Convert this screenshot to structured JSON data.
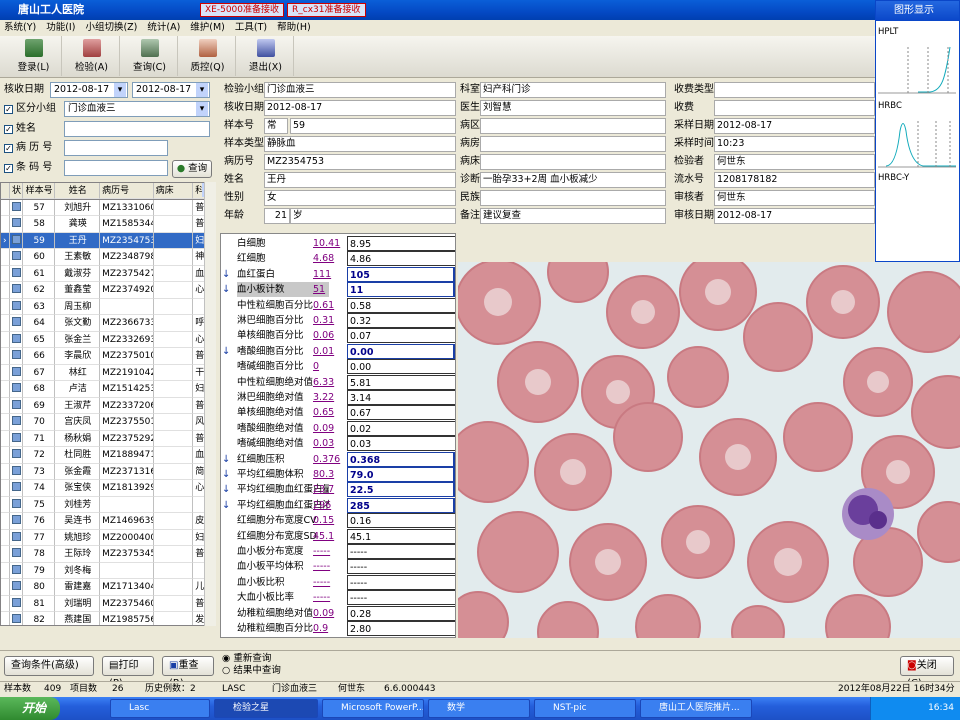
{
  "window": {
    "title": "唐山工人医院",
    "tabs": [
      "XE-5000准备接收",
      "R_cx31准备接收"
    ]
  },
  "menu": [
    "系统(Y)",
    "功能(I)",
    "小组切换(Z)",
    "统计(A)",
    "维护(M)",
    "工具(T)",
    "帮助(H)"
  ],
  "toolbar": [
    "登录(L)",
    "检验(A)",
    "查询(C)",
    "质控(Q)",
    "退出(X)"
  ],
  "filter": {
    "date_label": "核收日期",
    "date_from": "2012-08-17",
    "date_to": "2012-08-17",
    "group_label": "区分小组",
    "group_value": "门诊血液三",
    "name_label": "姓名",
    "record_label": "病 历 号",
    "barcode_label": "条 码 号",
    "query_btn": "查询"
  },
  "grid": {
    "headers": [
      "",
      "",
      "样本号",
      "姓名",
      "病历号",
      "病床",
      "科"
    ],
    "rows": [
      {
        "no": "57",
        "name": "刘旭升",
        "id": "MZ1331060",
        "dept": "普"
      },
      {
        "no": "58",
        "name": "龚瑛",
        "id": "MZ1585344",
        "dept": "普"
      },
      {
        "no": "59",
        "name": "王丹",
        "id": "MZ2354753",
        "dept": "妇",
        "sel": true
      },
      {
        "no": "60",
        "name": "王素敏",
        "id": "MZ2348798",
        "dept": "神"
      },
      {
        "no": "61",
        "name": "戴淑芬",
        "id": "MZ2375427",
        "dept": "血"
      },
      {
        "no": "62",
        "name": "董鑫莹",
        "id": "MZ2374920",
        "dept": "心"
      },
      {
        "no": "63",
        "name": "周玉柳",
        "id": "",
        "dept": ""
      },
      {
        "no": "64",
        "name": "张文勤",
        "id": "MZ2366733",
        "dept": "呼"
      },
      {
        "no": "65",
        "name": "张金兰",
        "id": "MZ2332693",
        "dept": "心"
      },
      {
        "no": "66",
        "name": "李晨欣",
        "id": "MZ2375010",
        "dept": "普"
      },
      {
        "no": "67",
        "name": "林红",
        "id": "MZ2191042",
        "dept": "干"
      },
      {
        "no": "68",
        "name": "卢洁",
        "id": "MZ1514253",
        "dept": "妇"
      },
      {
        "no": "69",
        "name": "王淑芹",
        "id": "MZ2337206",
        "dept": "普"
      },
      {
        "no": "70",
        "name": "宫庆凤",
        "id": "MZ2375501",
        "dept": "风"
      },
      {
        "no": "71",
        "name": "杨秋娟",
        "id": "MZ2375292",
        "dept": "普"
      },
      {
        "no": "72",
        "name": "杜同胜",
        "id": "MZ1889471",
        "dept": "血"
      },
      {
        "no": "73",
        "name": "张金霞",
        "id": "MZ2371316",
        "dept": "简"
      },
      {
        "no": "74",
        "name": "张宝侠",
        "id": "MZ1813929",
        "dept": "心"
      },
      {
        "no": "75",
        "name": "刘桂芳",
        "id": "",
        "dept": ""
      },
      {
        "no": "76",
        "name": "吴连书",
        "id": "MZ1469639",
        "dept": "皮"
      },
      {
        "no": "77",
        "name": "姚旭珍",
        "id": "MZ2000400",
        "dept": "妇"
      },
      {
        "no": "78",
        "name": "王际玲",
        "id": "MZ2375345",
        "dept": "普"
      },
      {
        "no": "79",
        "name": "刘冬梅",
        "id": "",
        "dept": ""
      },
      {
        "no": "80",
        "name": "雷建嘉",
        "id": "MZ1713404",
        "dept": "儿"
      },
      {
        "no": "81",
        "name": "刘瑞明",
        "id": "MZ2375460",
        "dept": "普"
      },
      {
        "no": "82",
        "name": "燕建国",
        "id": "MZ1985756",
        "dept": "发"
      },
      {
        "no": "83",
        "name": "左金荣",
        "id": "MZ1797108",
        "dept": "简"
      },
      {
        "no": "84",
        "name": "宋凯学",
        "id": "MZ2375653",
        "dept": "血",
        "yel": true
      }
    ]
  },
  "info": {
    "group_l": "检验小组",
    "group_v": "门诊血液三",
    "date_l": "核收日期",
    "date_v": "2012-08-17",
    "sample_l": "样本号",
    "sample_type": "常",
    "sample_v": "59",
    "stype_l": "样本类型",
    "stype_v": "静脉血",
    "rec_l": "病历号",
    "rec_v": "MZ2354753",
    "name_l": "姓名",
    "name_v": "王丹",
    "sex_l": "性别",
    "sex_v": "女",
    "age_l": "年龄",
    "age_v": "21",
    "age_u": "岁",
    "dept_l": "科室",
    "dept_v": "妇产科门诊",
    "doc_l": "医生",
    "doc_v": "刘智慧",
    "area_l": "病区",
    "room_l": "病房",
    "bed_l": "病床",
    "diag_l": "诊断",
    "diag_v": "一胎孕33+2周  血小板减少",
    "nation_l": "民族",
    "note_l": "备注",
    "note_v": "建议复查",
    "fee_type_l": "收费类型",
    "fee_l": "收费",
    "cdate_l": "采样日期",
    "cdate_v": "2012-08-17",
    "ctime_l": "采样时间",
    "ctime_v": "10:23",
    "tester_l": "检验者",
    "tester_v": "何世东",
    "flow_l": "流水号",
    "flow_v": "1208178182",
    "checker_l": "审核者",
    "checker_v": "何世东",
    "cdate2_l": "审核日期",
    "cdate2_v": "2012-08-17"
  },
  "results": [
    {
      "name": "白细胞",
      "abbr": "10.41",
      "value": "8.95"
    },
    {
      "name": "红细胞",
      "abbr": "4.68",
      "value": "4.86"
    },
    {
      "name": "血红蛋白",
      "abbr": "111",
      "value": "105",
      "flag": "↓"
    },
    {
      "name": "血小板计数",
      "abbr": "51",
      "value": "11",
      "flag": "↓",
      "hl": true
    },
    {
      "name": "中性粒细胞百分比",
      "abbr": "0.61",
      "value": "0.58"
    },
    {
      "name": "淋巴细胞百分比",
      "abbr": "0.31",
      "value": "0.32"
    },
    {
      "name": "单核细胞百分比",
      "abbr": "0.06",
      "value": "0.07"
    },
    {
      "name": "嗜酸细胞百分比",
      "abbr": "0.01",
      "value": "0.00",
      "flag": "↓"
    },
    {
      "name": "嗜碱细胞百分比",
      "abbr": "0",
      "value": "0.00"
    },
    {
      "name": "中性粒细胞绝对值",
      "abbr": "6.33",
      "value": "5.81"
    },
    {
      "name": "淋巴细胞绝对值",
      "abbr": "3.22",
      "value": "3.14"
    },
    {
      "name": "单核细胞绝对值",
      "abbr": "0.65",
      "value": "0.67"
    },
    {
      "name": "嗜酸细胞绝对值",
      "abbr": "0.09",
      "value": "0.02"
    },
    {
      "name": "嗜碱细胞绝对值",
      "abbr": "0.03",
      "value": "0.03"
    },
    {
      "name": "红细胞压积",
      "abbr": "0.376",
      "value": "0.368",
      "flag": "↓"
    },
    {
      "name": "平均红细胞体积",
      "abbr": "80.3",
      "value": "79.0",
      "flag": "↓"
    },
    {
      "name": "平均红细胞血红蛋白量",
      "abbr": "23.7",
      "value": "22.5",
      "flag": "↓"
    },
    {
      "name": "平均红细胞血红蛋白浓度",
      "abbr": "296",
      "value": "285",
      "flag": "↓"
    },
    {
      "name": "红细胞分布宽度CV",
      "abbr": "0.15",
      "value": "0.16"
    },
    {
      "name": "红细胞分布宽度SD",
      "abbr": "45.1",
      "value": "45.1"
    },
    {
      "name": "血小板分布宽度",
      "abbr": "-----",
      "value": "-----"
    },
    {
      "name": "血小板平均体积",
      "abbr": "-----",
      "value": "-----"
    },
    {
      "name": "血小板比积",
      "abbr": "-----",
      "value": "-----"
    },
    {
      "name": "大血小板比率",
      "abbr": "-----",
      "value": "-----"
    },
    {
      "name": "幼稚粒细胞绝对值",
      "abbr": "0.09",
      "value": "0.28"
    },
    {
      "name": "幼稚粒细胞百分比",
      "abbr": "0.9",
      "value": "2.80"
    }
  ],
  "graph": {
    "title": "图形显示",
    "labels": [
      "HPLT",
      "HRBC",
      "HRBC-Y"
    ]
  },
  "bottom": {
    "cond": "查询条件(高级)",
    "print": "打印(P)",
    "reset": "重查(R)",
    "opt1": "重新查询",
    "opt2": "结果中查询",
    "close": "关闭(C)"
  },
  "status": {
    "count_l": "样本数",
    "count_v": "409",
    "items_l": "项目数",
    "items_v": "26",
    "hist_l": "历史例数：2",
    "lab": "LASC",
    "group": "门诊血液三",
    "user": "何世东",
    "ver": "6.6.000443",
    "datetime": "2012年08月22日 16时34分 星期三"
  },
  "taskbar": {
    "start": "开始",
    "tasks": [
      "Lasc",
      "检验之星",
      "Microsoft PowerP...",
      "数学",
      "NST-pic",
      "唐山工人医院推片..."
    ],
    "clock": "16:34"
  }
}
